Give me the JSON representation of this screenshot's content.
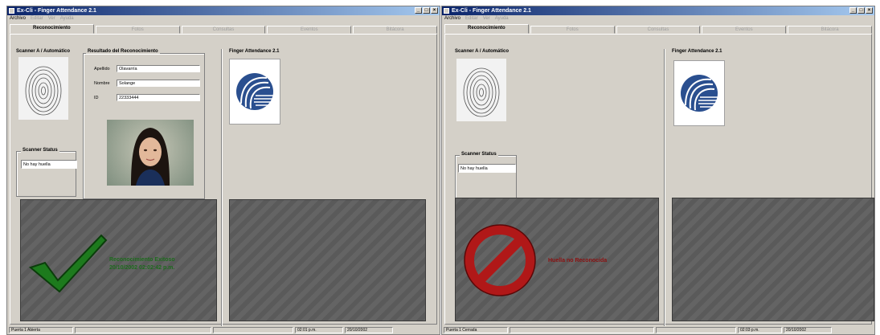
{
  "windows": [
    {
      "title": "Ex-Cli - Finger Attendance 2.1",
      "menu": [
        "Archivo",
        "Editar",
        "Ver",
        "Ayuda"
      ],
      "tabs": [
        "Reconocimiento",
        "Fotos",
        "Consultas",
        "Eventos",
        "Bitácora"
      ],
      "scanner_label": "Scanner A / Automático",
      "result_label": "Resultado del Reconocimiento",
      "fields": [
        {
          "label": "Apellido",
          "value": "Olavarría"
        },
        {
          "label": "Nombre",
          "value": "Solange"
        },
        {
          "label": "ID",
          "value": "22333444"
        }
      ],
      "scanner_status_label": "Scanner Status",
      "scanner_status_value": "No hay huella",
      "app_label": "Finger Attendance 2.1",
      "message_line1": "Reconocimiento Exitoso",
      "message_line2": "20/10/2002 02:02:42 p.m.",
      "status": [
        "Puerta 1 Abierta",
        "",
        "02:01 p.m.",
        "20/10/2002"
      ]
    },
    {
      "title": "Ex-Cli - Finger Attendance 2.1",
      "menu": [
        "Archivo",
        "Editar",
        "Ver",
        "Ayuda"
      ],
      "tabs": [
        "Reconocimiento",
        "Fotos",
        "Consultas",
        "Eventos",
        "Bitácora"
      ],
      "scanner_label": "Scanner A / Automático",
      "scanner_status_label": "Scanner Status",
      "scanner_status_value": "No hay huella",
      "app_label": "Finger Attendance 2.1",
      "message_line1": "Huella no Reconocida",
      "status": [
        "Puerta 1 Cerrada",
        "",
        "02:03 p.m.",
        "20/10/2002"
      ]
    }
  ],
  "colors": {
    "success": "#1d6b1d",
    "error": "#8a1010",
    "accent": "#2a4f8f"
  }
}
